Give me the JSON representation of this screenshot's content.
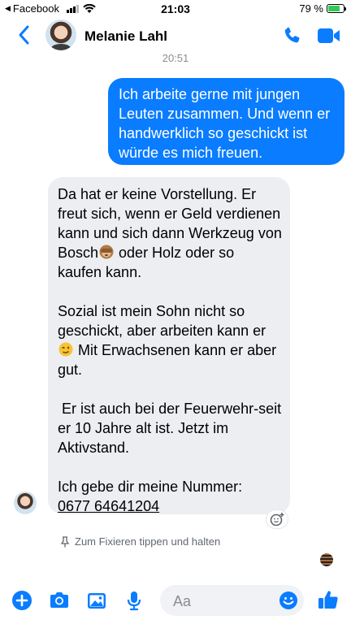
{
  "status_bar": {
    "back_app": "Facebook",
    "time": "21:03",
    "battery": "79 %",
    "battery_level": 0.79
  },
  "header": {
    "contact_name": "Melanie Lahl"
  },
  "conversation": {
    "timestamp": "20:51",
    "outgoing_message": "Ich arbeite gerne mit jungen Leuten zusammen. Und wenn er handwerklich so geschickt ist würde es mich freuen.",
    "incoming": {
      "p1": "Da hat er keine Vorstellung. Er freut sich, wenn er Geld verdienen kann und sich dann Werkzeug von Bosch",
      "p1_after_emoji": " oder Holz oder so kaufen kann.",
      "p2": "Sozial ist mein Sohn nicht so geschickt, aber arbeiten kann er",
      "p2_after_emoji": " Mit Erwachsenen kann er aber gut.",
      "p3": " Er ist auch bei der Feuerwehr-seit er 10 Jahre alt ist. Jetzt im Aktivstand.",
      "p4": "Ich gebe dir meine Nummer:",
      "phone": "0677 64641204"
    },
    "pin_hint": "Zum Fixieren tippen und halten"
  },
  "composer": {
    "placeholder": "Aa"
  },
  "colors": {
    "accent": "#0a7cff",
    "incoming_bubble": "#eceef1"
  }
}
